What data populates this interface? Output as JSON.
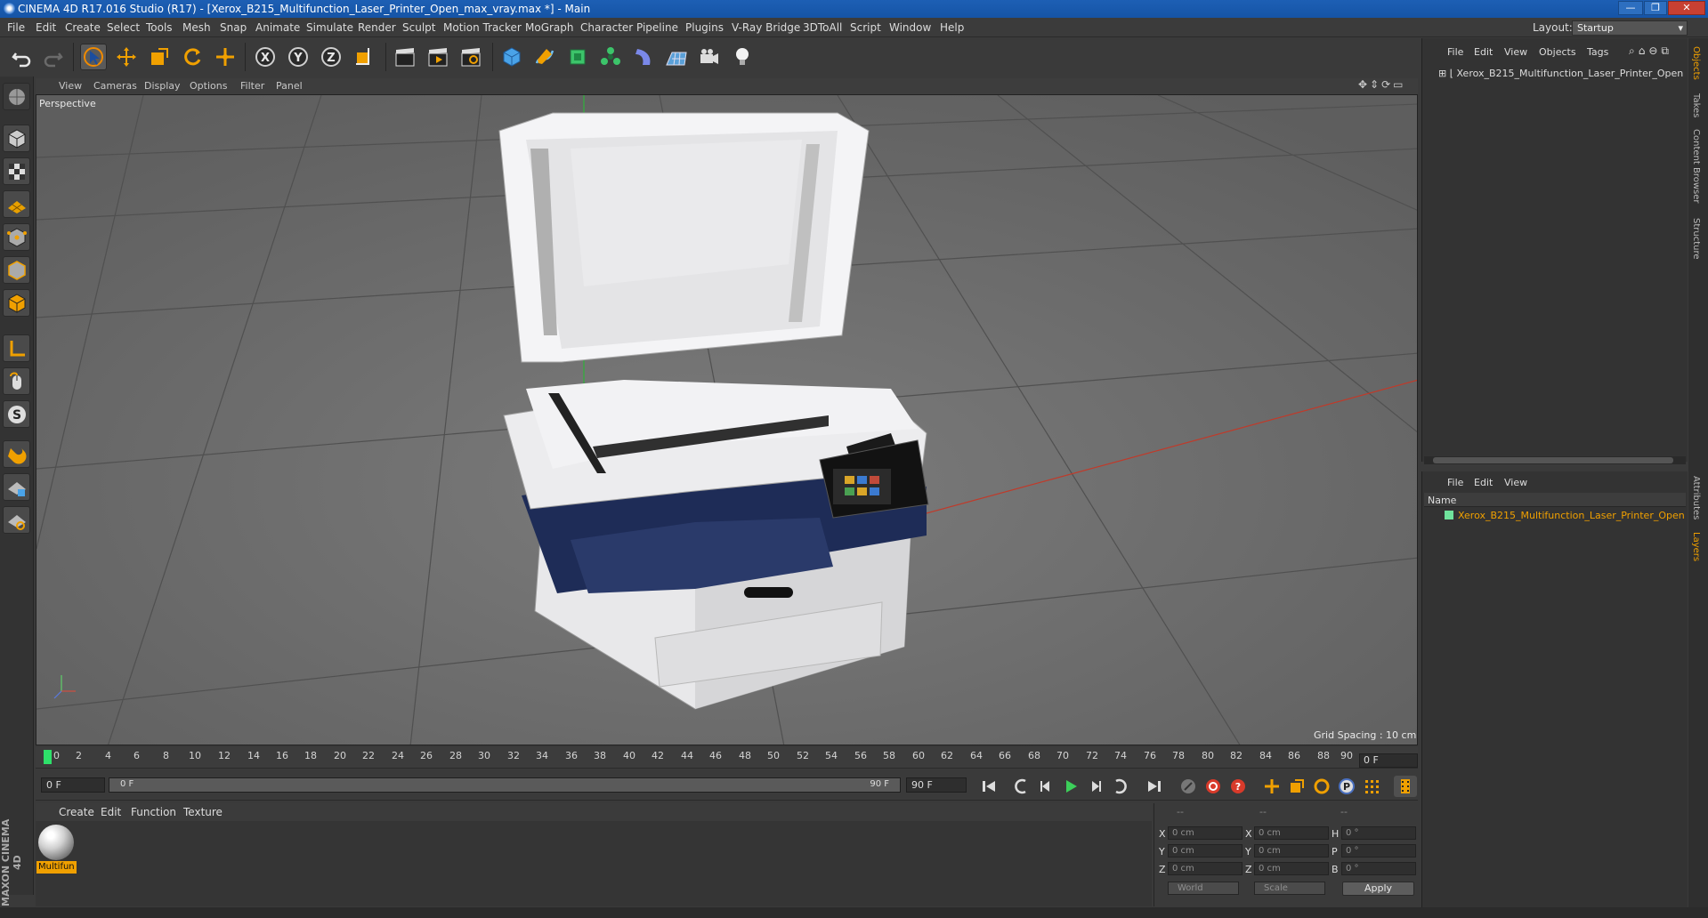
{
  "window": {
    "title": "CINEMA 4D R17.016 Studio (R17) - [Xerox_B215_Multifunction_Laser_Printer_Open_max_vray.max *] - Main",
    "min": "—",
    "max": "❐",
    "close": "✕"
  },
  "menu": [
    "File",
    "Edit",
    "Create",
    "Select",
    "Tools",
    "Mesh",
    "Snap",
    "Animate",
    "Simulate",
    "Render",
    "Sculpt",
    "Motion Tracker",
    "MoGraph",
    "Character",
    "Pipeline",
    "Plugins",
    "V-Ray Bridge",
    "3DToAll",
    "Script",
    "Window",
    "Help"
  ],
  "layout": {
    "label": "Layout:",
    "value": "Startup"
  },
  "toolbar": {
    "x_label": "X",
    "y_label": "Y",
    "z_label": "Z"
  },
  "viewport": {
    "menu": [
      "View",
      "Cameras",
      "Display",
      "Options",
      "Filter",
      "Panel"
    ],
    "camera": "Perspective",
    "grid_spacing": "Grid Spacing : 10 cm",
    "nav_glyphs": "✥⇕⟳▭"
  },
  "timeline": {
    "ticks": [
      "0",
      "2",
      "4",
      "6",
      "8",
      "10",
      "12",
      "14",
      "16",
      "18",
      "20",
      "22",
      "24",
      "26",
      "28",
      "30",
      "32",
      "34",
      "36",
      "38",
      "40",
      "42",
      "44",
      "46",
      "48",
      "50",
      "52",
      "54",
      "56",
      "58",
      "60",
      "62",
      "64",
      "66",
      "68",
      "70",
      "72",
      "74",
      "76",
      "78",
      "80",
      "82",
      "84",
      "86",
      "88",
      "90"
    ],
    "current": "0 F",
    "end": "0 F"
  },
  "transport": {
    "start": "0 F",
    "range_start": "0 F",
    "range_end": "90 F",
    "end": "90 F"
  },
  "materials": {
    "menu": [
      "Create",
      "Edit",
      "Function",
      "Texture"
    ],
    "items": [
      {
        "name": "Multifun"
      }
    ]
  },
  "coords": {
    "headers": [
      "--",
      "--",
      "--"
    ],
    "rows": [
      {
        "a": "X",
        "av": "0 cm",
        "b": "X",
        "bv": "0 cm",
        "c": "H",
        "cv": "0 °"
      },
      {
        "a": "Y",
        "av": "0 cm",
        "b": "Y",
        "bv": "0 cm",
        "c": "P",
        "cv": "0 °"
      },
      {
        "a": "Z",
        "av": "0 cm",
        "b": "Z",
        "bv": "0 cm",
        "c": "B",
        "cv": "0 °"
      }
    ],
    "world": "World",
    "scale": "Scale",
    "apply": "Apply"
  },
  "objects": {
    "menu": [
      "File",
      "Edit",
      "View",
      "Objects",
      "Tags"
    ],
    "item": "Xerox_B215_Multifunction_Laser_Printer_Open"
  },
  "layers": {
    "menu": [
      "File",
      "Edit",
      "View"
    ],
    "header": "Name",
    "item": "Xerox_B215_Multifunction_Laser_Printer_Open"
  },
  "side_tabs": [
    "Objects",
    "Takes",
    "Content Browser",
    "Structure",
    "Attributes",
    "Layers"
  ],
  "brand": "MAXON CINEMA 4D",
  "colors": {
    "accent": "#f0a000",
    "playhead": "#2ee06a",
    "titlebar": "#1d5fb4"
  }
}
